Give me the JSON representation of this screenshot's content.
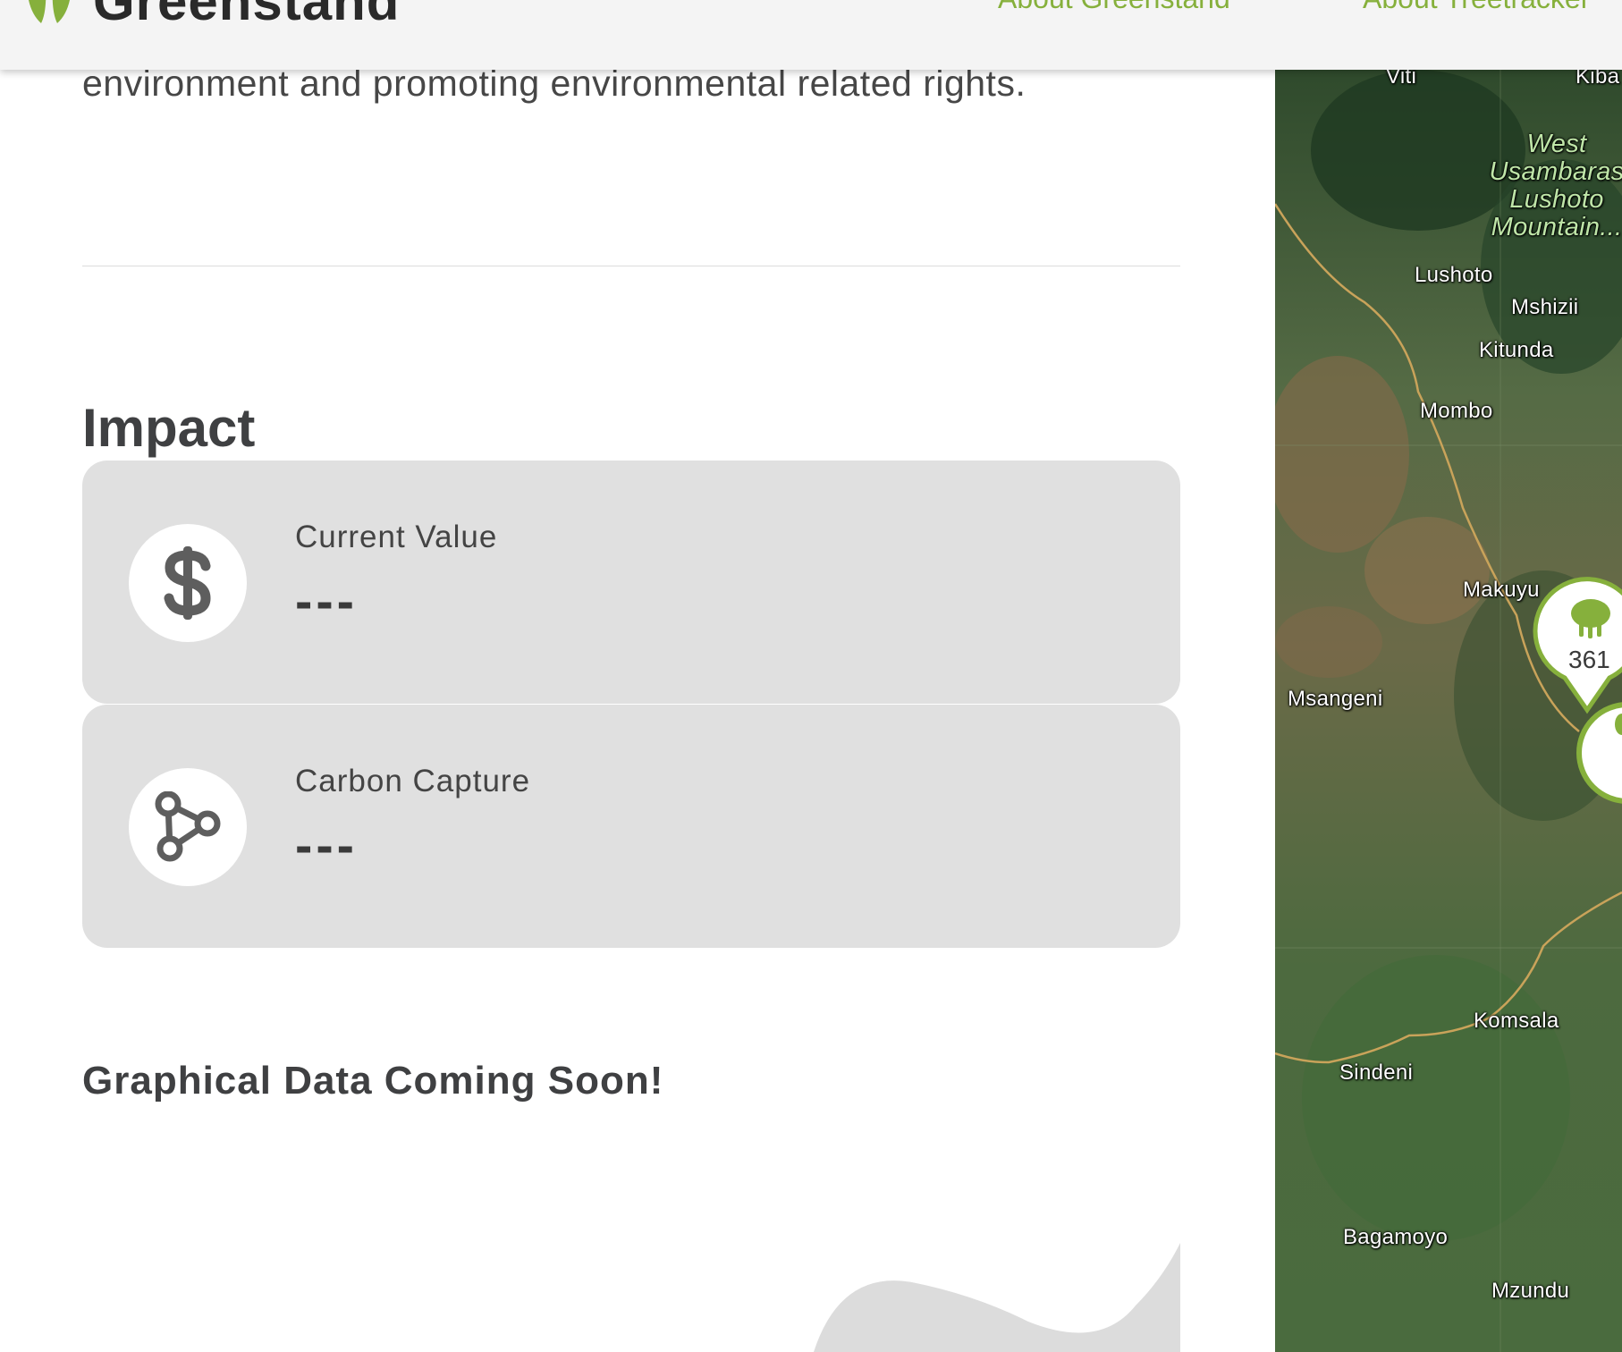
{
  "header": {
    "brand": "Greenstand",
    "nav": [
      "About Greenstand",
      "About Treetracker"
    ]
  },
  "intro_text": "environment and promoting environmental related rights.",
  "impact": {
    "title": "Impact",
    "cards": [
      {
        "label": "Current Value",
        "value": "---",
        "icon": "dollar-icon"
      },
      {
        "label": "Carbon Capture",
        "value": "---",
        "icon": "share-nodes-icon"
      }
    ]
  },
  "graph_notice": "Graphical Data Coming Soon!",
  "map": {
    "places": [
      "Viti",
      "Kiba",
      "West Usambaras Lushoto Mountain...",
      "Lushoto",
      "Mshizii",
      "Kitunda",
      "Mombo",
      "Makuyu",
      "Msangeni",
      "Komsala",
      "Sindeni",
      "Bagamoyo",
      "Mzundu"
    ],
    "cluster_count": "361"
  },
  "colors": {
    "accent_green": "#86b03c",
    "card_bg": "#e0e0e0",
    "text_dark": "#3f4042"
  }
}
